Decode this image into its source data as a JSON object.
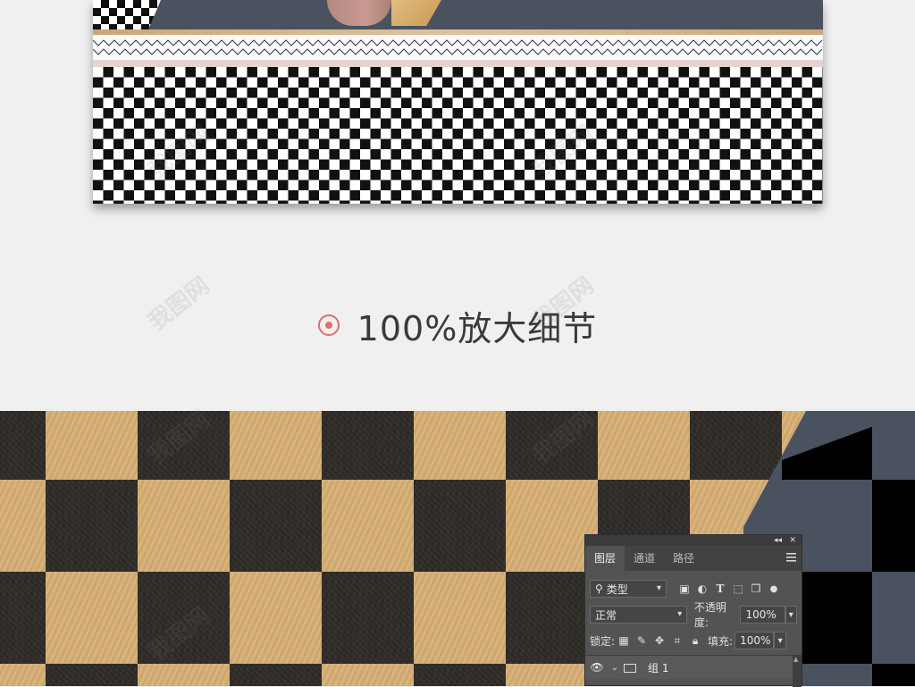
{
  "heading": {
    "text": "100%放大细节"
  },
  "watermark": {
    "text": "我图网"
  },
  "panel": {
    "tabs": [
      "图层",
      "通道",
      "路径"
    ],
    "filter_label": "类型",
    "blend_mode": "正常",
    "opacity_label": "不透明度:",
    "opacity_value": "100%",
    "lock_label": "锁定:",
    "fill_label": "填充:",
    "fill_value": "100%",
    "layer_name": "组 1"
  },
  "colors": {
    "accent_red": "#e06c6c",
    "gold": "#d9b57e",
    "slate": "#4a5260",
    "panel_bg": "#535353"
  }
}
